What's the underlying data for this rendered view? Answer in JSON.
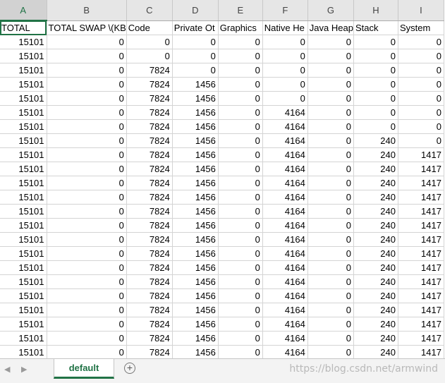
{
  "columns": [
    "A",
    "B",
    "C",
    "D",
    "E",
    "F",
    "G",
    "H",
    "I"
  ],
  "header_row": [
    "TOTAL",
    "TOTAL SWAP \\(KB",
    "Code",
    "Private Ot",
    "Graphics",
    "Native He",
    "Java Heap",
    "Stack",
    "System"
  ],
  "rows": [
    [
      "15101",
      "0",
      "0",
      "0",
      "0",
      "0",
      "0",
      "0",
      "0"
    ],
    [
      "15101",
      "0",
      "0",
      "0",
      "0",
      "0",
      "0",
      "0",
      "0"
    ],
    [
      "15101",
      "0",
      "7824",
      "0",
      "0",
      "0",
      "0",
      "0",
      "0"
    ],
    [
      "15101",
      "0",
      "7824",
      "1456",
      "0",
      "0",
      "0",
      "0",
      "0"
    ],
    [
      "15101",
      "0",
      "7824",
      "1456",
      "0",
      "0",
      "0",
      "0",
      "0"
    ],
    [
      "15101",
      "0",
      "7824",
      "1456",
      "0",
      "4164",
      "0",
      "0",
      "0"
    ],
    [
      "15101",
      "0",
      "7824",
      "1456",
      "0",
      "4164",
      "0",
      "0",
      "0"
    ],
    [
      "15101",
      "0",
      "7824",
      "1456",
      "0",
      "4164",
      "0",
      "240",
      "0"
    ],
    [
      "15101",
      "0",
      "7824",
      "1456",
      "0",
      "4164",
      "0",
      "240",
      "1417"
    ],
    [
      "15101",
      "0",
      "7824",
      "1456",
      "0",
      "4164",
      "0",
      "240",
      "1417"
    ],
    [
      "15101",
      "0",
      "7824",
      "1456",
      "0",
      "4164",
      "0",
      "240",
      "1417"
    ],
    [
      "15101",
      "0",
      "7824",
      "1456",
      "0",
      "4164",
      "0",
      "240",
      "1417"
    ],
    [
      "15101",
      "0",
      "7824",
      "1456",
      "0",
      "4164",
      "0",
      "240",
      "1417"
    ],
    [
      "15101",
      "0",
      "7824",
      "1456",
      "0",
      "4164",
      "0",
      "240",
      "1417"
    ],
    [
      "15101",
      "0",
      "7824",
      "1456",
      "0",
      "4164",
      "0",
      "240",
      "1417"
    ],
    [
      "15101",
      "0",
      "7824",
      "1456",
      "0",
      "4164",
      "0",
      "240",
      "1417"
    ],
    [
      "15101",
      "0",
      "7824",
      "1456",
      "0",
      "4164",
      "0",
      "240",
      "1417"
    ],
    [
      "15101",
      "0",
      "7824",
      "1456",
      "0",
      "4164",
      "0",
      "240",
      "1417"
    ],
    [
      "15101",
      "0",
      "7824",
      "1456",
      "0",
      "4164",
      "0",
      "240",
      "1417"
    ],
    [
      "15101",
      "0",
      "7824",
      "1456",
      "0",
      "4164",
      "0",
      "240",
      "1417"
    ],
    [
      "15101",
      "0",
      "7824",
      "1456",
      "0",
      "4164",
      "0",
      "240",
      "1417"
    ],
    [
      "15101",
      "0",
      "7824",
      "1456",
      "0",
      "4164",
      "0",
      "240",
      "1417"
    ],
    [
      "15101",
      "0",
      "7824",
      "1456",
      "0",
      "4164",
      "0",
      "240",
      "1417"
    ],
    [
      "15101",
      "0",
      "7824",
      "1456",
      "0",
      "4164",
      "0",
      "240",
      "1417"
    ]
  ],
  "tabbar": {
    "prev_arrow": "◀",
    "next_arrow": "▶",
    "sheet_tab": "default",
    "add_sheet": "+",
    "watermark": "https://blog.csdn.net/armwind"
  },
  "colors": {
    "accent": "#217346",
    "grid": "#d4d4d4",
    "header_bg": "#e6e6e6"
  }
}
